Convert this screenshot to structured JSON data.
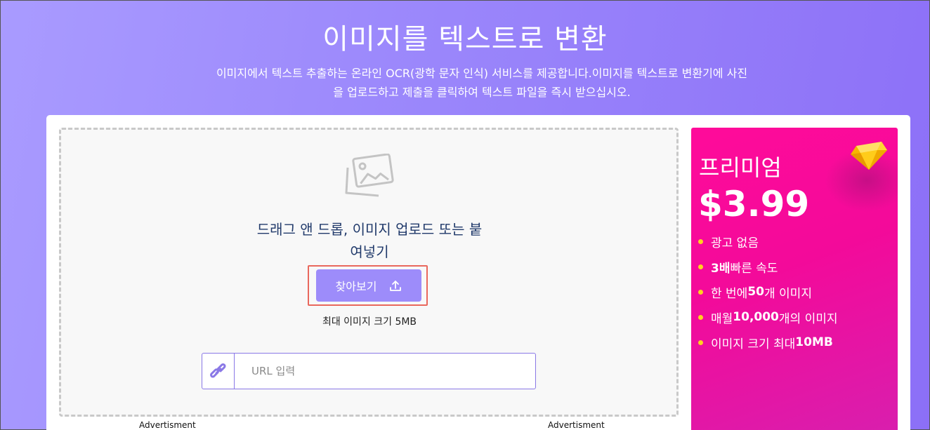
{
  "hero": {
    "title": "이미지를 텍스트로 변환",
    "subtitle_line1": "이미지에서 텍스트 추출하는 온라인 OCR(광학 문자 인식) 서비스를 제공합니다.이미지를 텍스트로 변환기에 사진",
    "subtitle_line2": "을 업로드하고 제출을 클릭하여 텍스트 파일을 즉시 받으십시오."
  },
  "upload": {
    "icon": "image-placeholder-icon",
    "drop_line1": "드래그 앤 드롭, 이미지 업로드 또는 붙",
    "drop_line2": "여넣기",
    "browse_label": "찾아보기",
    "browse_icon": "upload-arrow-icon",
    "max_size": "최대 이미지 크기 5MB",
    "url_icon": "link-icon",
    "url_placeholder": "URL 입력",
    "url_value": ""
  },
  "ads": {
    "left_label": "Advertisment",
    "right_label": "Advertisment"
  },
  "premium": {
    "title": "프리미엄",
    "price": "$3.99",
    "icon": "diamond-icon",
    "features": [
      {
        "bold": "",
        "text": "광고 없음"
      },
      {
        "bold": "3배",
        "text": " 빠른 속도"
      },
      {
        "pre": "한 번에 ",
        "bold": "50",
        "text": "개 이미지"
      },
      {
        "pre": "매월 ",
        "bold": "10,000",
        "text": "개의 이미지"
      },
      {
        "pre": "이미지 크기 최대 ",
        "bold": "10MB",
        "text": ""
      }
    ]
  },
  "colors": {
    "accent": "#9d8cfa",
    "premium_pink": "#ff0b9a",
    "bullet_yellow": "#ffd21f",
    "highlight_red": "#e9685d"
  }
}
